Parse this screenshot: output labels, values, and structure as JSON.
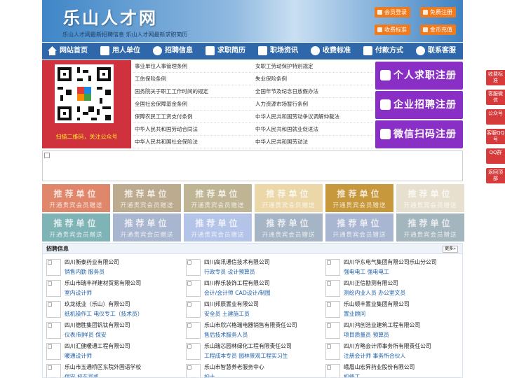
{
  "header": {
    "logo": "乐山人才网",
    "slogan": "乐山人才网最新招聘信息    乐山人才网最新求职简历",
    "buttons": [
      "会员登录",
      "免费注册",
      "收费标准",
      "金币充值"
    ]
  },
  "nav": [
    "网站首页",
    "用人单位",
    "招聘信息",
    "求职简历",
    "职场资讯",
    "收费标准",
    "付款方式",
    "联系客服"
  ],
  "qr_caption": "扫描二维码，关注公众号",
  "policies": [
    "事业单位人事管理条例",
    "女职工劳动保护特别规定",
    "工伤保险条例",
    "失业保险条例",
    "国务院关于职工工作时间的规定",
    "全国年节及纪念日放假办法",
    "全国社会保障基金条例",
    "人力资源市场暂行条例",
    "保障农民工工资支付条例",
    "中华人民共和国劳动争议调解仲裁法",
    "中华人民共和国劳动合同法",
    "中华人民共和国就业促进法",
    "中华人民共和国社会保险法",
    "中华人民共和国劳动法"
  ],
  "register": [
    "个人求职注册",
    "企业招聘注册",
    "微信扫码注册"
  ],
  "tiles": {
    "title": "推荐单位",
    "subtitle": "开通贵宾会员赠送",
    "colors": [
      "#e0876b",
      "#bcab8e",
      "#bfb594",
      "#ecd7a9",
      "#c8983d",
      "#e8e0cf",
      "#7fb4b6",
      "#a9b6d0",
      "#b4c4e8",
      "#a5b5c6",
      "#a9b6d2",
      "#a3b6bd"
    ]
  },
  "jobs_section": {
    "title": "招聘信息",
    "more": "更多»",
    "items": [
      {
        "company": "四川衡泰药业有限公司",
        "positions": "销售内勤 服务员"
      },
      {
        "company": "四川高讯通信技术有限公司",
        "positions": "行政专员 设计预算员"
      },
      {
        "company": "四川华东电气集团有限公司乐山分公司",
        "positions": "强电电工 强电电工"
      },
      {
        "company": "乐山市瑞丰祥建材贸易有限公司",
        "positions": "室内设计师"
      },
      {
        "company": "四川桦乐装饰工程有限公司",
        "positions": "会计/会计师 CAD设计/制图"
      },
      {
        "company": "四川正信勘测有限公司",
        "positions": "测绘内业人员 办公室文员"
      },
      {
        "company": "玖龙纸业（乐山）有限公司",
        "positions": "纸机操作工 电仪专工（技术员）"
      },
      {
        "company": "四川邦辰置业有限公司",
        "positions": "安全员 土建施工员"
      },
      {
        "company": "乐山顿丰置业集团有限公司",
        "positions": "置业顾问"
      },
      {
        "company": "四川德胜集团钒钛有限公司",
        "positions": "仪表/制样员 保安"
      },
      {
        "company": "乐山市欣兴格瑞电器销售有限责任公司",
        "positions": "售后技术服务人员"
      },
      {
        "company": "四川鸿创浩业建筑工程有限公司",
        "positions": "项目质量员 预算员"
      },
      {
        "company": "四川汇健暖通工程有限公司",
        "positions": "暖通设计师"
      },
      {
        "company": "乐山瑞芯园林绿化工程有限责任公司",
        "positions": "工程成本专员 园林景观工程实习生"
      },
      {
        "company": "四川方略会计师事务所有限责任公司",
        "positions": "注册会计师 事务所合伙人"
      },
      {
        "company": "乐山市五通桥区东院外国语学校",
        "positions": "保安 校车司机"
      },
      {
        "company": "乐山市智慧养老服务中心",
        "positions": "护士"
      },
      {
        "company": "峨眉山宏昇药业股份有限公司",
        "positions": "机修工"
      }
    ]
  },
  "side_bar": [
    "收费标准",
    "客服微信",
    "公众号",
    "客服QQ号",
    "QQ群",
    "返回顶部"
  ]
}
